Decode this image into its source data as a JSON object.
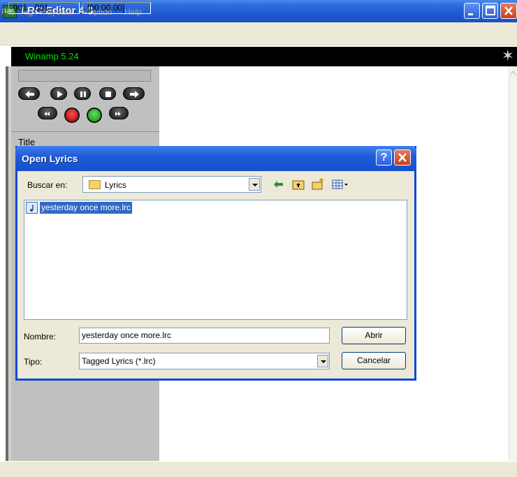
{
  "app": {
    "title": "LRC Editor 4.0",
    "icon_label": "LRC",
    "menu": [
      "File",
      "Tag",
      "Playback",
      "Option",
      "Help"
    ]
  },
  "player": {
    "name": "Winamp 5.24",
    "title_label": "Title"
  },
  "status": {
    "line_range": "001 - 001",
    "timestamp": "[00:00.00]"
  },
  "dialog": {
    "title": "Open Lyrics",
    "help_label": "?",
    "look_in_label": "Buscar en:",
    "look_in_value": "Lyrics",
    "files": [
      {
        "name": "yesterday once more.lrc",
        "selected": true
      }
    ],
    "name_label": "Nombre:",
    "name_value": "yesterday once more.lrc",
    "type_label": "Tipo:",
    "type_value": "Tagged Lyrics  (*.lrc)",
    "open_label": "Abrir",
    "cancel_label": "Cancelar"
  },
  "colors": {
    "title_bar": "#1f5ad1",
    "selection": "#316ac5",
    "winamp_text": "#00e000"
  },
  "icons": [
    "back-icon",
    "up-folder-icon",
    "new-folder-icon",
    "view-menu-icon"
  ]
}
